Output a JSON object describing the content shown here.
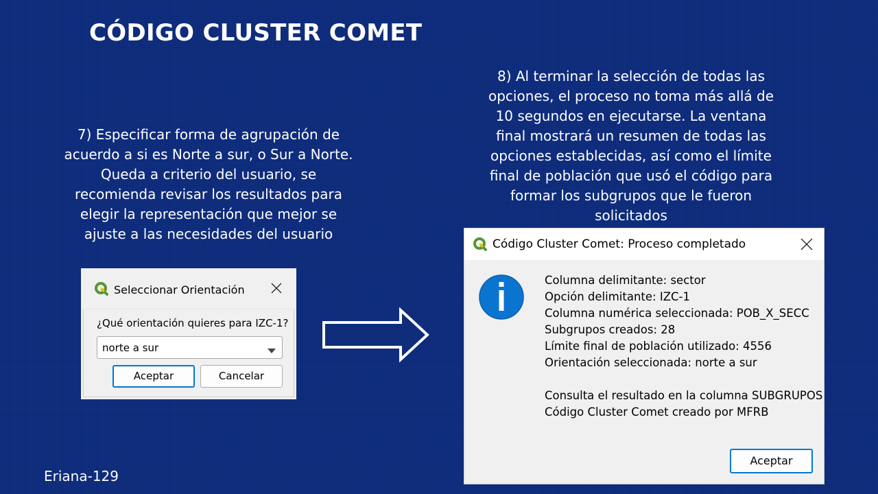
{
  "slide": {
    "title": "CÓDIGO CLUSTER COMET",
    "author": "Eriana-129",
    "step7_lines": [
      "7) Especificar forma de agrupación de",
      "acuerdo a si es Norte a sur, o Sur a Norte.",
      "Queda a criterio del usuario, se",
      "recomienda revisar los resultados para",
      "elegir la representación que mejor se",
      "ajuste a las necesidades del usuario"
    ],
    "step8_lines": [
      "8) Al terminar la selección de todas las",
      "opciones, el proceso no toma más allá de",
      "10 segundos en ejecutarse. La ventana",
      "final mostrará un resumen de todas las",
      "opciones establecidas, así como el límite",
      "final de población que usó el código para",
      "formar los subgrupos que le fueron",
      "solicitados"
    ]
  },
  "orientation_dialog": {
    "title": "Seleccionar Orientación",
    "question": "¿Qué orientación quieres para IZC-1?",
    "selected_option": "norte a sur",
    "accept_label": "Aceptar",
    "cancel_label": "Cancelar"
  },
  "result_dialog": {
    "title": "Código Cluster Comet: Proceso completado",
    "summary_lines": [
      "Columna delimitante: sector",
      "Opción delimitante: IZC-1",
      "Columna numérica seleccionada: POB_X_SECC",
      "Subgrupos creados: 28",
      "Límite final de población utilizado: 4556",
      "Orientación seleccionada: norte a sur"
    ],
    "footer_lines": [
      "Consulta el resultado en la columna SUBGRUPOS",
      "Código Cluster Comet creado por MFRB"
    ],
    "accept_label": "Aceptar"
  },
  "icons": {
    "app_logo": "qgis-logo-icon",
    "close": "close-icon",
    "dropdown": "chevron-down-icon",
    "info": "info-icon",
    "arrow": "right-arrow-icon"
  },
  "colors": {
    "background": "#0c2a7a",
    "info_blue": "#0a74d1",
    "qgis_green": "#589632",
    "qgis_yellow": "#eec90d",
    "button_focus": "#0078d7"
  }
}
